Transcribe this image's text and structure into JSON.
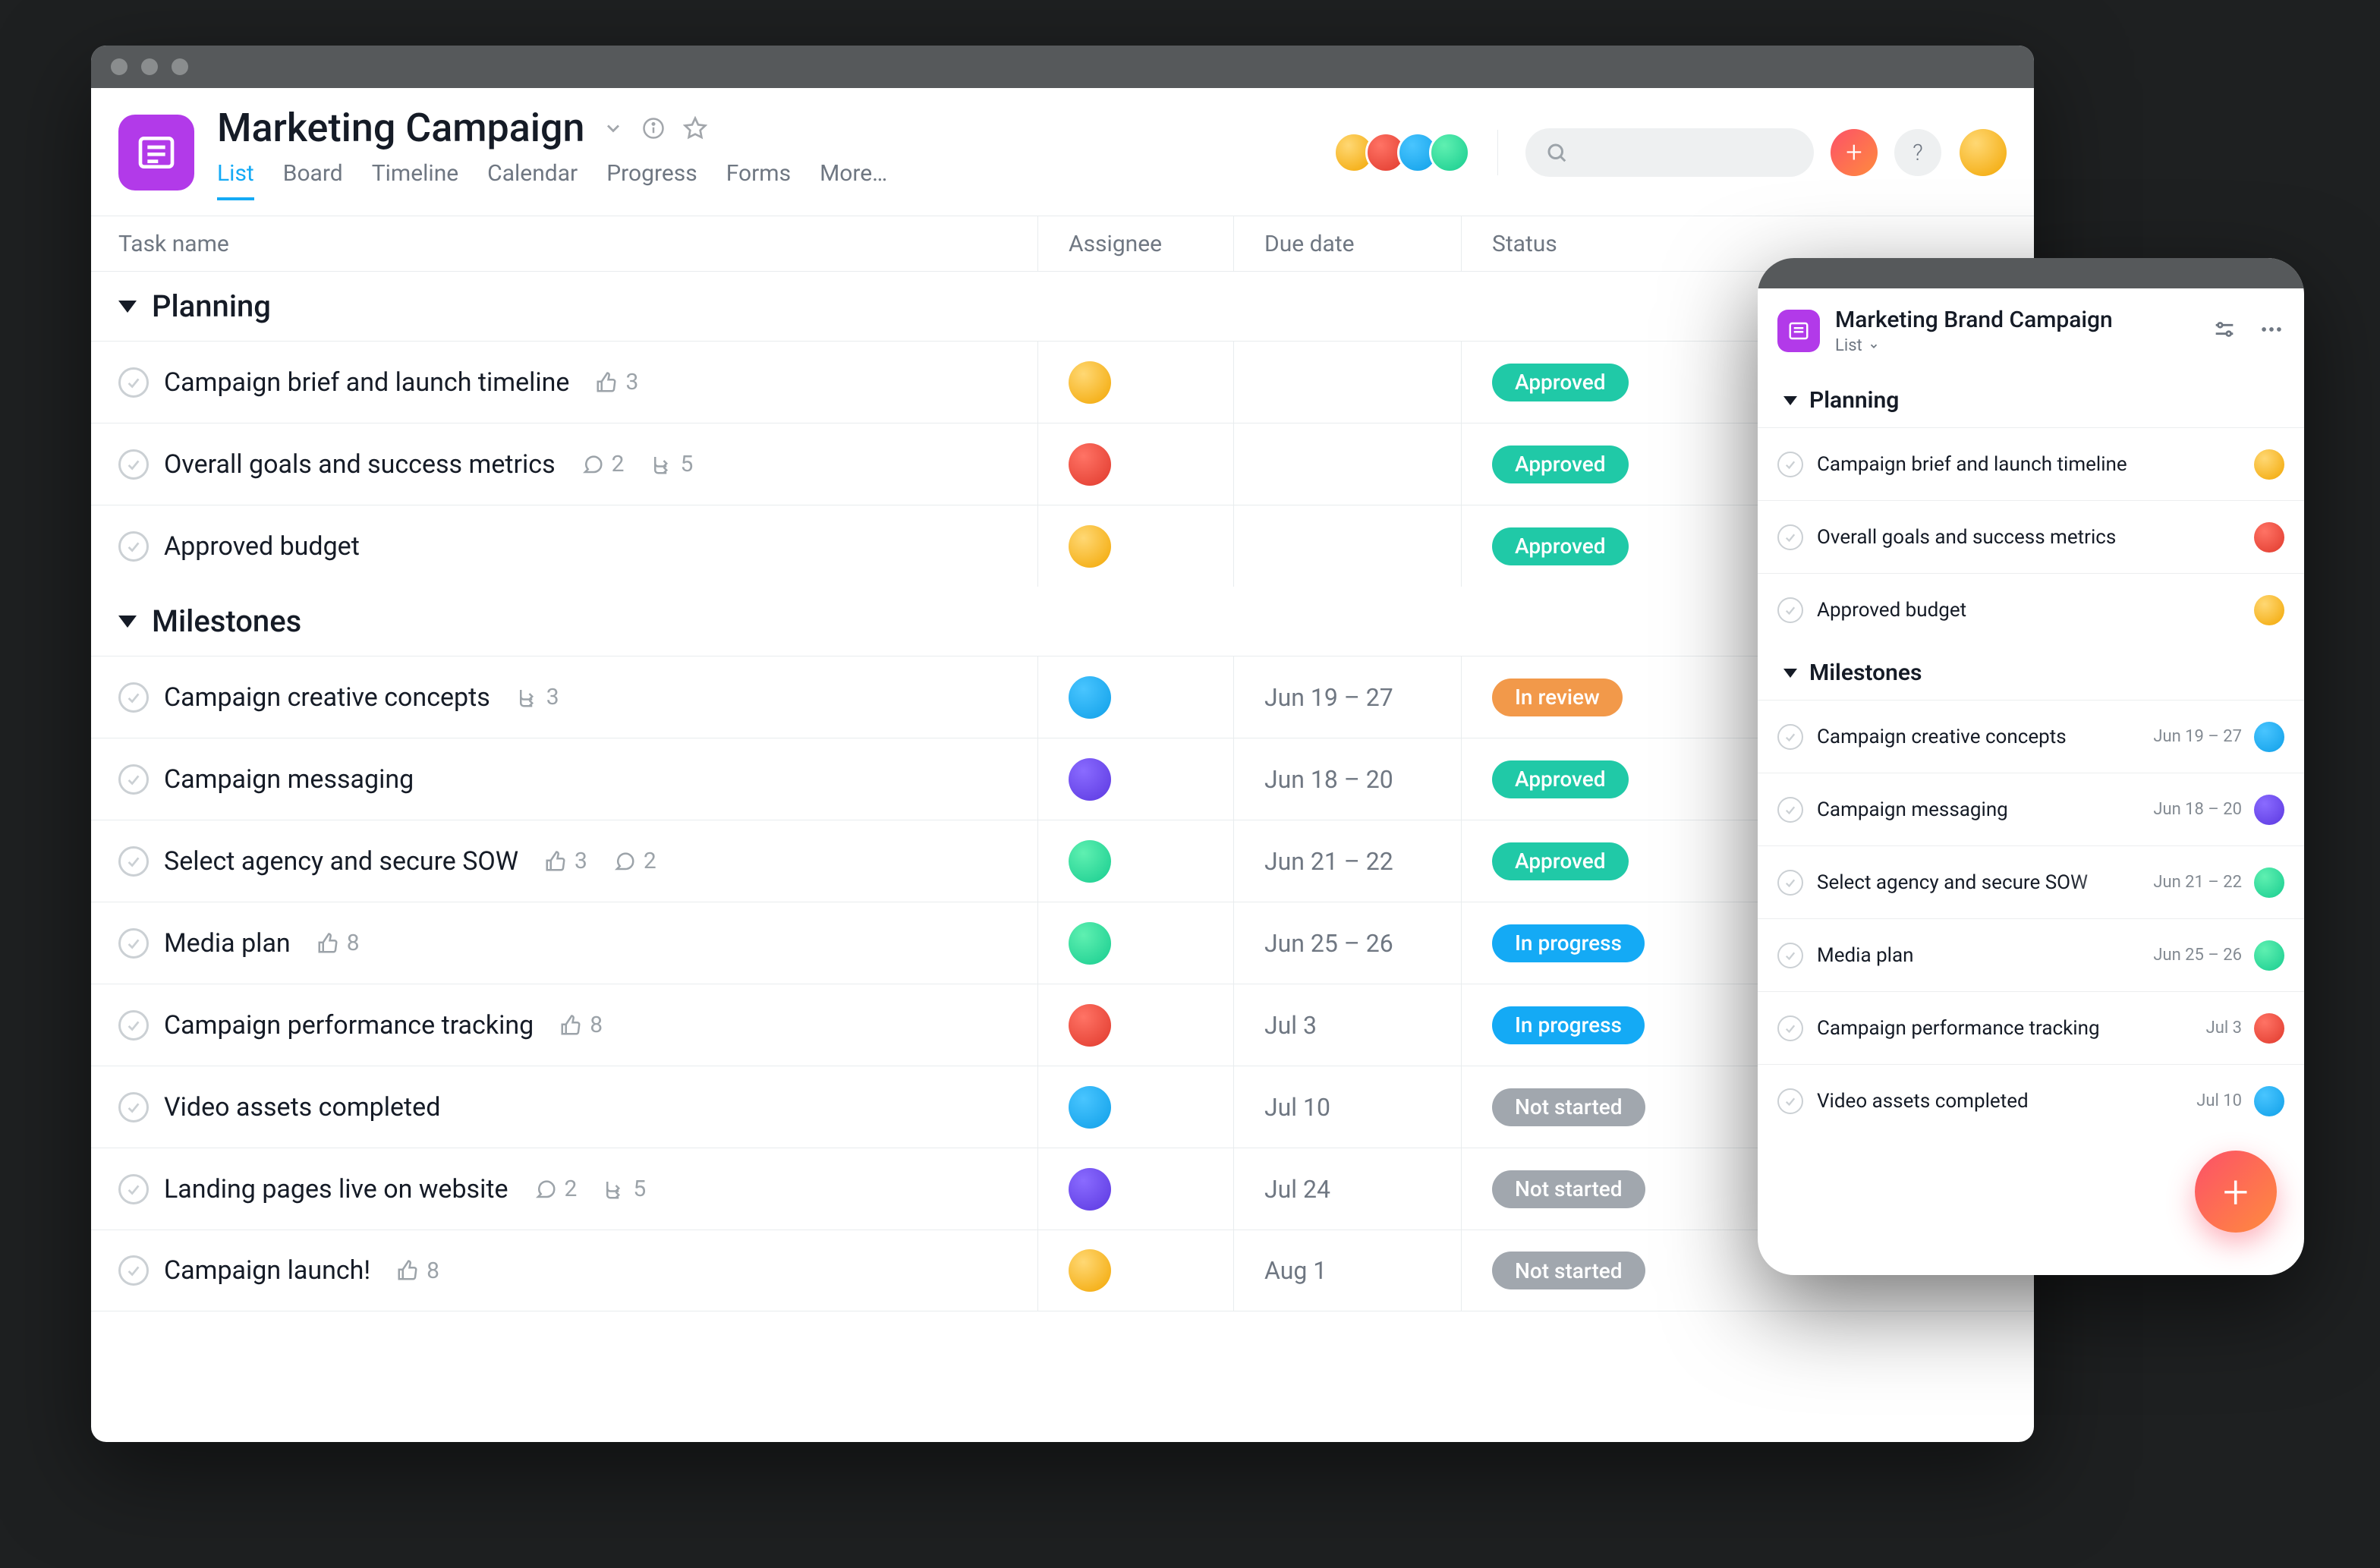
{
  "project": {
    "title": "Marketing Campaign",
    "icon": "project-icon",
    "tabs": [
      "List",
      "Board",
      "Timeline",
      "Calendar",
      "Progress",
      "Forms",
      "More…"
    ],
    "active_tab": 0
  },
  "columns": {
    "task": "Task name",
    "assignee": "Assignee",
    "due": "Due date",
    "status": "Status"
  },
  "statuses": {
    "approved": "Approved",
    "review": "In review",
    "progress": "In progress",
    "notstart": "Not started"
  },
  "sections": [
    {
      "name": "Planning",
      "tasks": [
        {
          "name": "Campaign brief and launch timeline",
          "likes": 3,
          "comments": null,
          "subtasks": null,
          "assignee": "yellow",
          "due": "",
          "status": "approved"
        },
        {
          "name": "Overall goals and success metrics",
          "likes": null,
          "comments": 2,
          "subtasks": 5,
          "assignee": "red",
          "due": "",
          "status": "approved"
        },
        {
          "name": "Approved budget",
          "likes": null,
          "comments": null,
          "subtasks": null,
          "assignee": "yellow",
          "due": "",
          "status": "approved"
        }
      ]
    },
    {
      "name": "Milestones",
      "tasks": [
        {
          "name": "Campaign creative concepts",
          "likes": null,
          "comments": null,
          "subtasks": 3,
          "assignee": "blue",
          "due": "Jun 19 – 27",
          "status": "review"
        },
        {
          "name": "Campaign messaging",
          "likes": null,
          "comments": null,
          "subtasks": null,
          "assignee": "purple",
          "due": "Jun 18 – 20",
          "status": "approved"
        },
        {
          "name": "Select agency and secure SOW",
          "likes": 3,
          "comments": 2,
          "subtasks": null,
          "assignee": "green",
          "due": "Jun 21 – 22",
          "status": "approved"
        },
        {
          "name": "Media plan",
          "likes": 8,
          "comments": null,
          "subtasks": null,
          "assignee": "green",
          "due": "Jun 25 – 26",
          "status": "progress"
        },
        {
          "name": "Campaign performance tracking",
          "likes": 8,
          "comments": null,
          "subtasks": null,
          "assignee": "red",
          "due": "Jul 3",
          "status": "progress"
        },
        {
          "name": "Video assets completed",
          "likes": null,
          "comments": null,
          "subtasks": null,
          "assignee": "blue",
          "due": "Jul 10",
          "status": "notstart"
        },
        {
          "name": "Landing pages live on website",
          "likes": null,
          "comments": 2,
          "subtasks": 5,
          "assignee": "purple",
          "due": "Jul 24",
          "status": "notstart"
        },
        {
          "name": "Campaign launch!",
          "likes": 8,
          "comments": null,
          "subtasks": null,
          "assignee": "yellow",
          "due": "Aug 1",
          "status": "notstart"
        }
      ]
    }
  ],
  "mobile": {
    "title": "Marketing Brand Campaign",
    "view": "List",
    "sections": [
      {
        "name": "Planning",
        "tasks": [
          {
            "name": "Campaign brief and launch timeline",
            "due": "",
            "assignee": "yellow",
            "fade": false
          },
          {
            "name": "Overall goals and success metrics",
            "due": "",
            "assignee": "red",
            "fade": false
          },
          {
            "name": "Approved budget",
            "due": "",
            "assignee": "yellow",
            "fade": false
          }
        ]
      },
      {
        "name": "Milestones",
        "tasks": [
          {
            "name": "Campaign creative concepts",
            "due": "Jun 19 – 27",
            "assignee": "blue",
            "fade": true
          },
          {
            "name": "Campaign messaging",
            "due": "Jun 18 – 20",
            "assignee": "purple",
            "fade": false
          },
          {
            "name": "Select agency and secure SOW",
            "due": "Jun 21 – 22",
            "assignee": "green",
            "fade": true
          },
          {
            "name": "Media plan",
            "due": "Jun 25 – 26",
            "assignee": "green",
            "fade": false
          },
          {
            "name": "Campaign performance tracking",
            "due": "Jul 3",
            "assignee": "red",
            "fade": true
          },
          {
            "name": "Video assets completed",
            "due": "Jul 10",
            "assignee": "blue",
            "fade": false
          }
        ]
      }
    ]
  }
}
